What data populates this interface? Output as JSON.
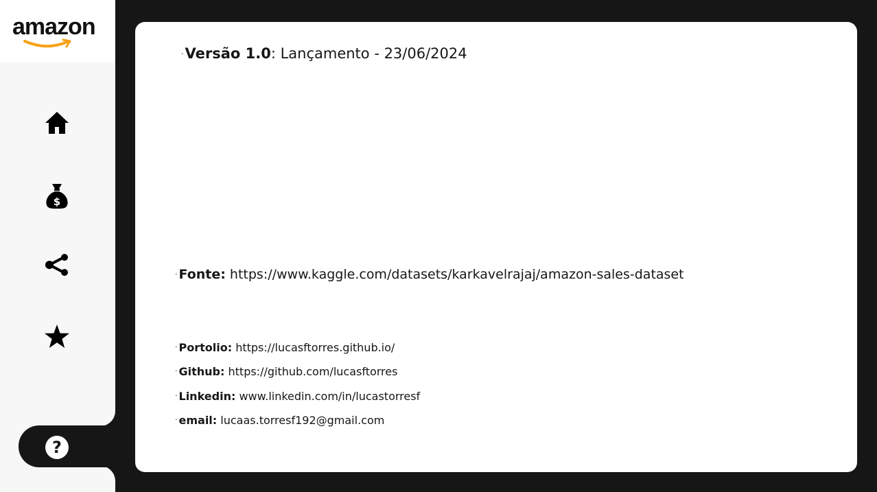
{
  "brand": {
    "logo_text": "amazon",
    "smile_color": "#F7A116"
  },
  "nav": {
    "items": [
      {
        "name": "home",
        "icon": "home-icon"
      },
      {
        "name": "sales",
        "icon": "money-bag-icon"
      },
      {
        "name": "share",
        "icon": "share-icon"
      },
      {
        "name": "favorites",
        "icon": "star-icon"
      }
    ],
    "help_icon": "question-icon",
    "help_glyph": "?"
  },
  "info": {
    "version": {
      "bullet": "·",
      "label": "Versão 1.0",
      "text": ": Lançamento - 23/06/2024"
    },
    "source": {
      "bullet": "·",
      "label": "Fonte:",
      "value": "https://www.kaggle.com/datasets/karkavelrajaj/amazon-sales-dataset"
    },
    "contacts": [
      {
        "bullet": "·",
        "label": "Portolio:",
        "value": "https://lucasftorres.github.io/"
      },
      {
        "bullet": "·",
        "label": "Github:",
        "value": "https://github.com/lucasftorres"
      },
      {
        "bullet": "·",
        "label": "Linkedin:",
        "value": "www.linkedin.com/in/lucastorresf"
      },
      {
        "bullet": "·",
        "label": "email:",
        "value": "lucaas.torresf192@gmail.com"
      }
    ]
  },
  "colors": {
    "frame": "#161616",
    "sidebar": "#F7F7F7",
    "card": "#FFFFFF",
    "text": "#161616"
  }
}
